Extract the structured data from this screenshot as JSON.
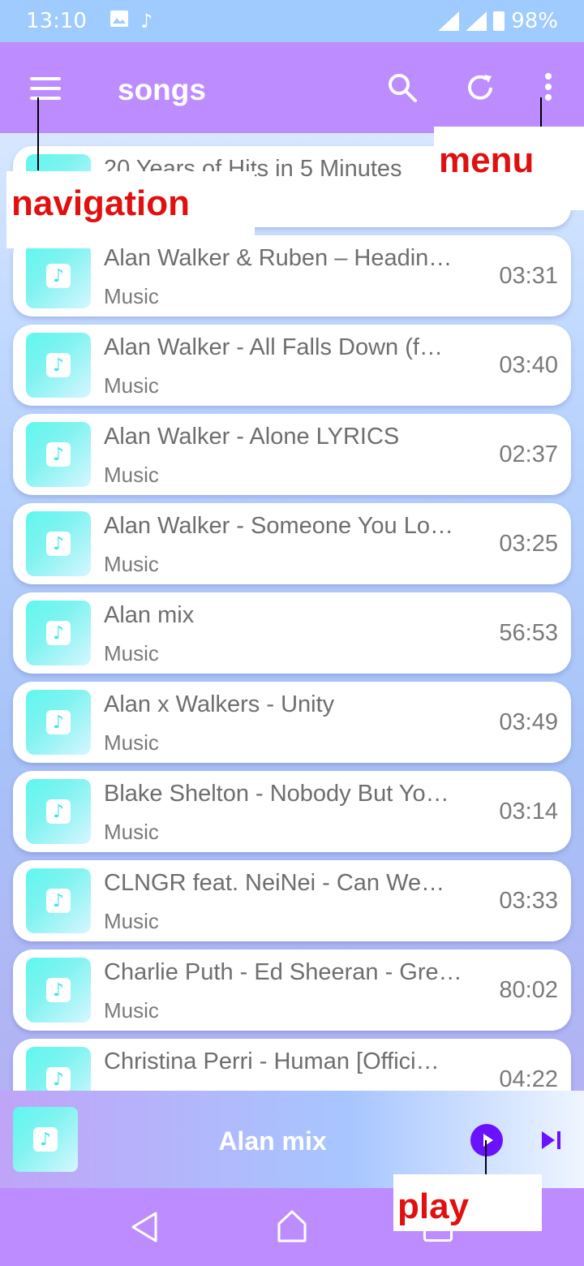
{
  "status_bar": {
    "time": "13:10",
    "icons": [
      "image-icon",
      "music-note-icon"
    ],
    "battery": "98%"
  },
  "app_bar": {
    "title": "songs"
  },
  "songs": [
    {
      "title": "20 Years of Hits in 5 Minutes",
      "subtitle": "",
      "duration": ""
    },
    {
      "title": "Alan Walker & Ruben – Headin…",
      "subtitle": "Music",
      "duration": "03:31"
    },
    {
      "title": "Alan Walker - All Falls Down (f…",
      "subtitle": "Music",
      "duration": "03:40"
    },
    {
      "title": "Alan Walker - Alone LYRICS",
      "subtitle": "Music",
      "duration": "02:37"
    },
    {
      "title": "Alan Walker - Someone You Lo…",
      "subtitle": "Music",
      "duration": "03:25"
    },
    {
      "title": "Alan mix",
      "subtitle": "Music",
      "duration": "56:53"
    },
    {
      "title": "Alan x Walkers - Unity",
      "subtitle": "Music",
      "duration": "03:49"
    },
    {
      "title": "Blake Shelton - Nobody But Yo…",
      "subtitle": "Music",
      "duration": "03:14"
    },
    {
      "title": "CLNGR feat. NeiNei - Can We…",
      "subtitle": "Music",
      "duration": "03:33"
    },
    {
      "title": "Charlie Puth - Ed Sheeran - Gre…",
      "subtitle": "Music",
      "duration": "80:02"
    },
    {
      "title": "Christina Perri - Human [Offici…",
      "subtitle": "",
      "duration": "04:22"
    }
  ],
  "player": {
    "title": "Alan mix"
  },
  "annotations": {
    "navigation": "navigation",
    "menu": "menu",
    "play": "play"
  },
  "colors": {
    "app_bar": "#bd8cff",
    "status_bar": "#9fcbff",
    "play_button": "#6a11ff",
    "annotation_text": "#e01010"
  }
}
